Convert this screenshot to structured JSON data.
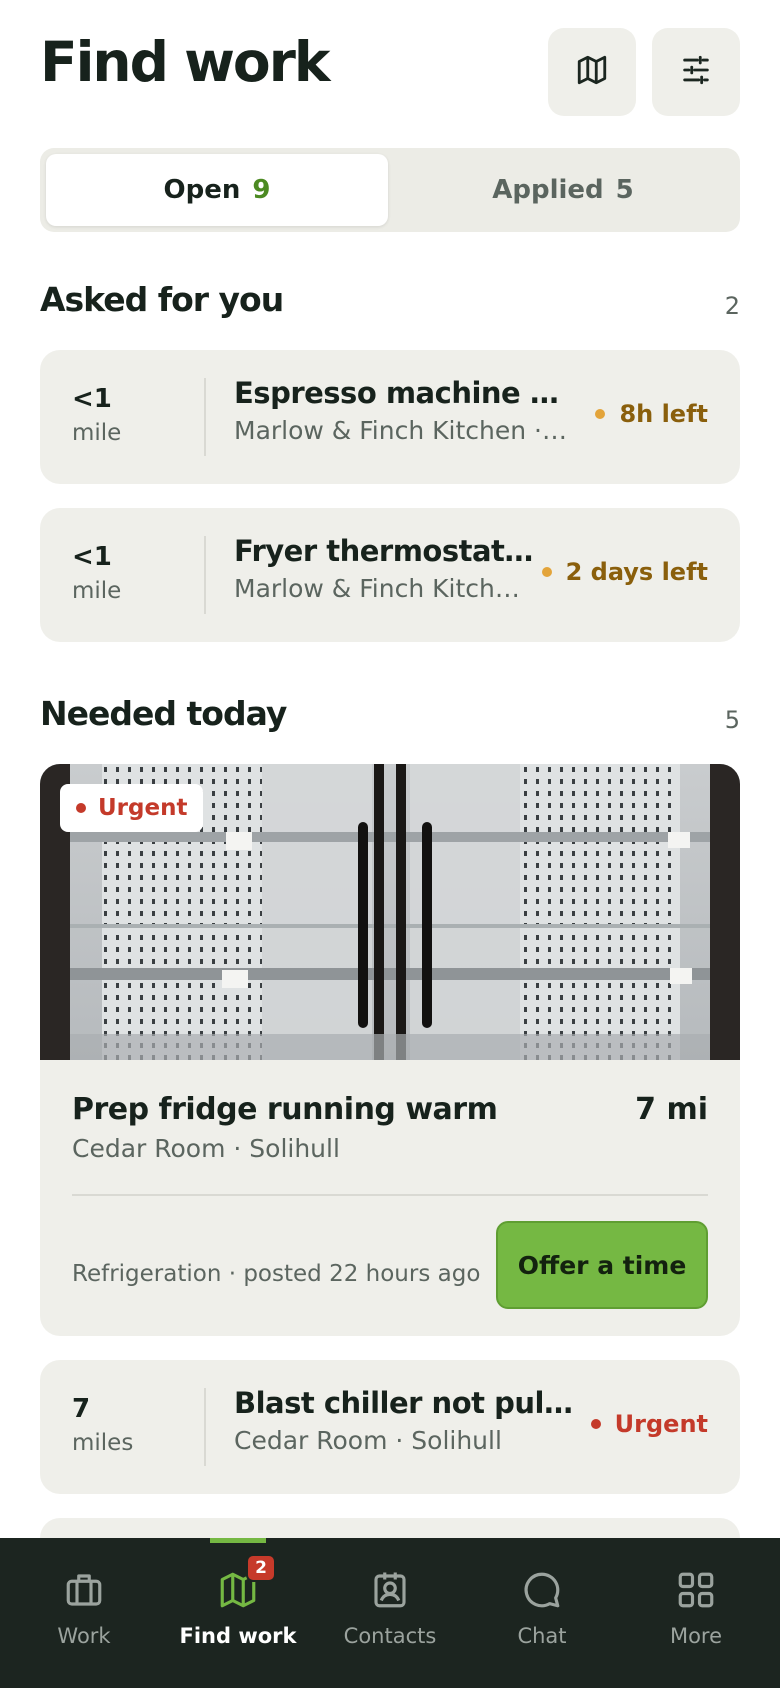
{
  "header": {
    "title": "Find work",
    "map_icon": "map-icon",
    "filter_icon": "sliders-icon"
  },
  "segments": {
    "open_label": "Open",
    "open_count": "9",
    "applied_label": "Applied",
    "applied_count": "5"
  },
  "asked": {
    "title": "Asked for you",
    "count": "2",
    "items": [
      {
        "distance": "<1",
        "unit": "mile",
        "title": "Espresso machine steam wand leaking",
        "subtitle": "Marlow & Finch Kitchen · Solihull",
        "status": "8h left"
      },
      {
        "distance": "<1",
        "unit": "mile",
        "title": "Fryer thermostat drifting",
        "subtitle": "Marlow & Finch Kitchen · Solihull",
        "status": "2 days left"
      }
    ]
  },
  "needed": {
    "title": "Needed today",
    "count": "5",
    "featured": {
      "badge": "Urgent",
      "title": "Prep fridge running warm",
      "distance": "7 mi",
      "subtitle": "Cedar Room · Solihull",
      "meta": "Refrigeration · posted 22 hours ago",
      "action": "Offer a time"
    },
    "items": [
      {
        "distance": "7",
        "unit": "miles",
        "title": "Blast chiller not pulling down",
        "subtitle": "Cedar Room · Solihull",
        "status": "Urgent"
      }
    ]
  },
  "tabbar": {
    "tabs": [
      {
        "label": "Work",
        "icon": "briefcase-icon"
      },
      {
        "label": "Find work",
        "icon": "map-icon",
        "badge": "2"
      },
      {
        "label": "Contacts",
        "icon": "contact-card-icon"
      },
      {
        "label": "Chat",
        "icon": "chat-bubble-icon"
      },
      {
        "label": "More",
        "icon": "grid-icon"
      }
    ],
    "active_index": 1
  },
  "colors": {
    "accent_green": "#75b843",
    "count_green": "#4c8a22",
    "urgent_red": "#c43a2a",
    "time_amber": "#e3a43a",
    "card_bg": "#efefea",
    "tabbar_bg": "#1c2520"
  }
}
